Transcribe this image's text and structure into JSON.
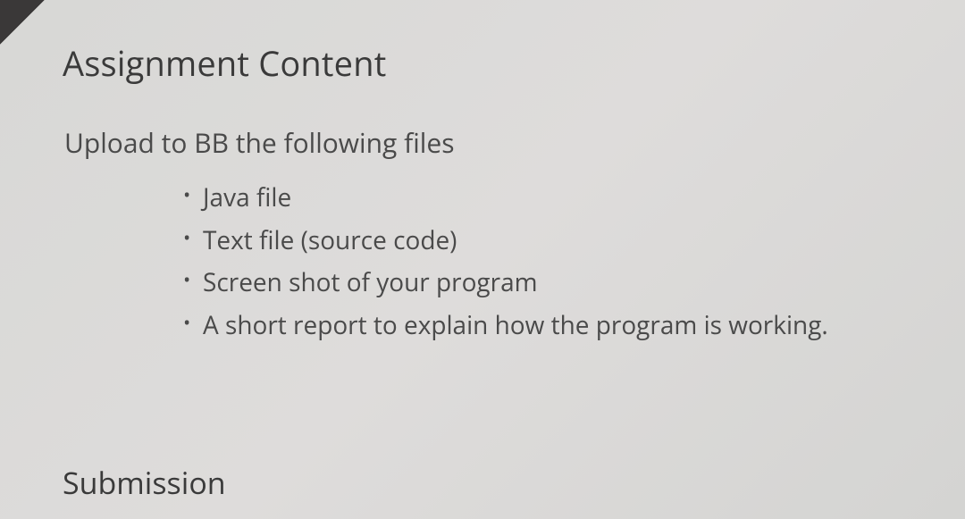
{
  "section1": {
    "title": "Assignment Content",
    "intro": "Upload to BB the following files",
    "items": [
      "Java file",
      "Text file (source code)",
      "Screen shot of your program",
      "A short report to explain how the program is working."
    ]
  },
  "section2": {
    "title": "Submission"
  }
}
